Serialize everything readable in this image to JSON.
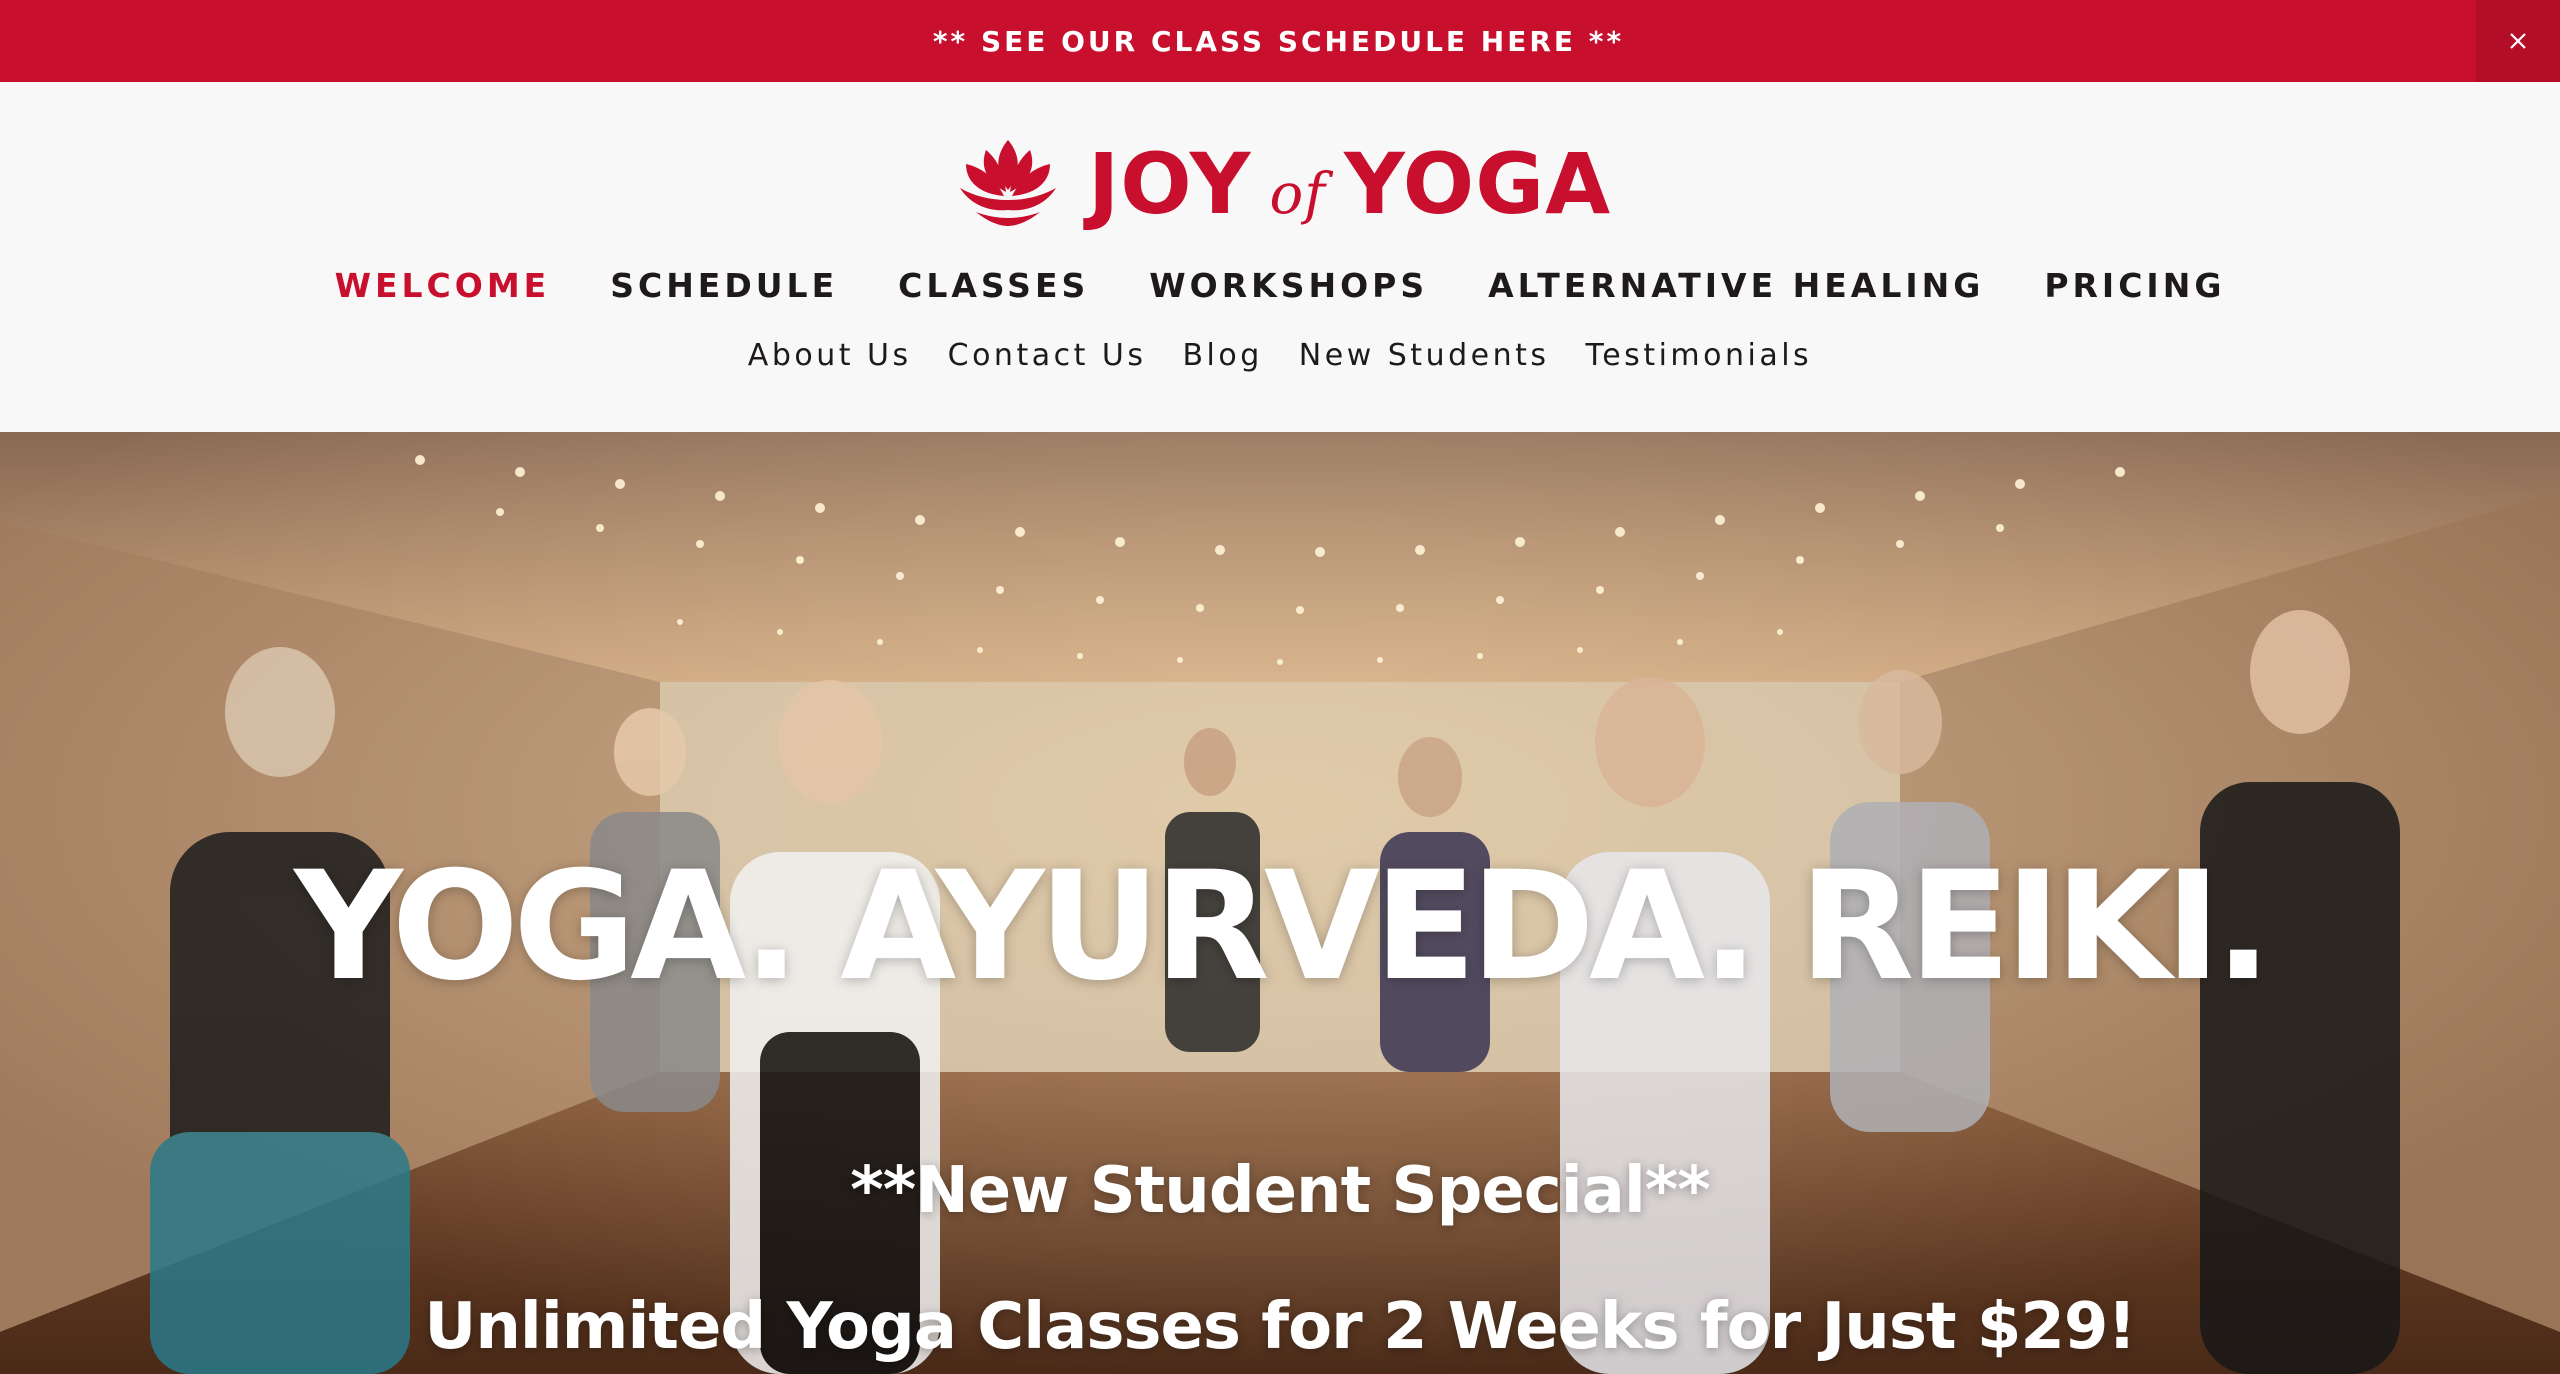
{
  "announcement": {
    "text": "** SEE OUR CLASS SCHEDULE HERE **",
    "close_icon": "close-icon"
  },
  "brand": {
    "name_left": "JOY",
    "name_mid": "of",
    "name_right": "YOGA",
    "logo_icon": "lotus-icon",
    "color": "#c8102e"
  },
  "main_nav": [
    {
      "label": "WELCOME",
      "active": true
    },
    {
      "label": "SCHEDULE"
    },
    {
      "label": "CLASSES"
    },
    {
      "label": "WORKSHOPS"
    },
    {
      "label": "ALTERNATIVE HEALING"
    },
    {
      "label": "PRICING"
    }
  ],
  "sub_nav": [
    {
      "label": "About Us"
    },
    {
      "label": "Contact Us"
    },
    {
      "label": "Blog"
    },
    {
      "label": "New Students"
    },
    {
      "label": "Testimonials"
    }
  ],
  "hero": {
    "headline": "YOGA. AYURVEDA. REIKI.",
    "special": "**New Student Special**",
    "offer": "Unlimited Yoga Classes for 2 Weeks for Just $29!"
  }
}
